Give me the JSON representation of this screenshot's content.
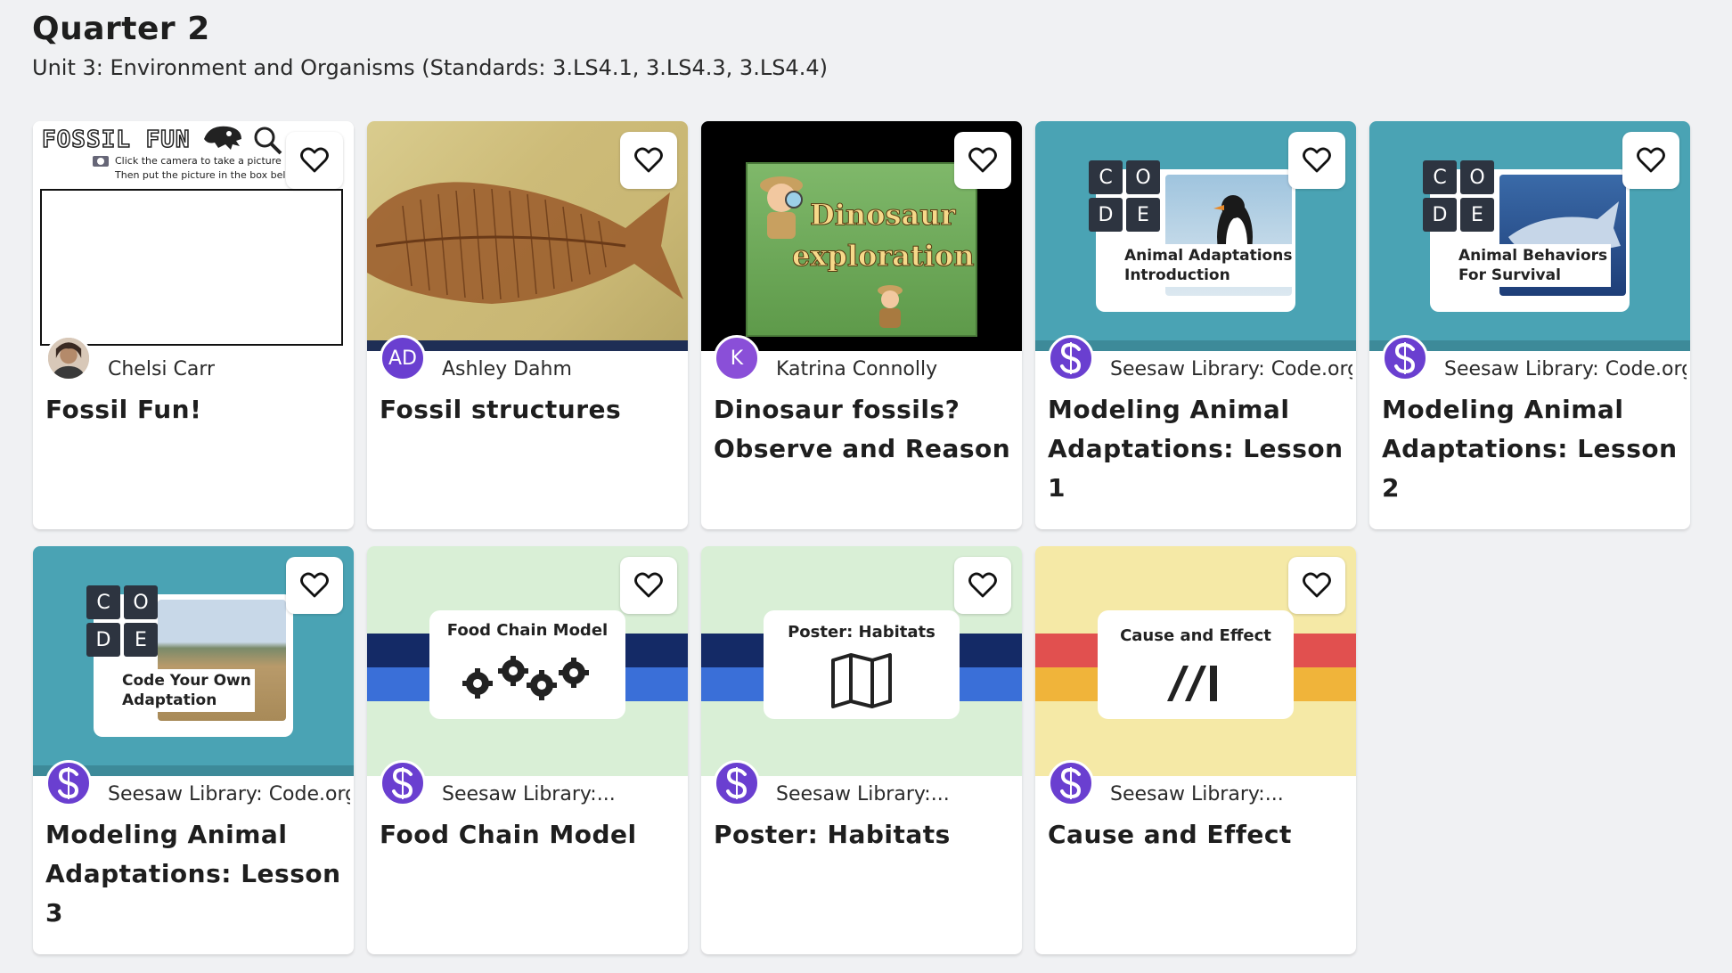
{
  "page": {
    "title": "Quarter 2",
    "subtitle": "Unit 3: Environment and Organisms (Standards: 3.LS4.1, 3.LS4.3, 3.LS4.4)"
  },
  "cards": [
    {
      "title": "Fossil Fun!",
      "author": "Chelsi Carr",
      "thumb": {
        "heading": "FOSSIL FUN",
        "instruction_1": "Click the camera to take a picture",
        "instruction_2": "Then put the picture in the box bel"
      }
    },
    {
      "title": "Fossil structures",
      "author": "Ashley Dahm",
      "avatar_initials": "AD"
    },
    {
      "title": "Dinosaur fossils? Observe and Reason",
      "author": "Katrina Connolly",
      "avatar_initials": "K",
      "thumb": {
        "line_1": "Dinosaur",
        "line_2": "exploration"
      }
    },
    {
      "title": "Modeling Animal Adaptations: Lesson 1",
      "author": "Seesaw Library: Code.org",
      "thumb": {
        "caption_1": "Animal Adaptations",
        "caption_2": "Introduction",
        "code": [
          "C",
          "O",
          "D",
          "E"
        ]
      }
    },
    {
      "title": "Modeling Animal Adaptations: Lesson 2",
      "author": "Seesaw Library: Code.org",
      "thumb": {
        "caption_1": "Animal Behaviors",
        "caption_2": "For Survival",
        "code": [
          "C",
          "O",
          "D",
          "E"
        ]
      }
    },
    {
      "title": "Modeling Animal Adaptations: Lesson 3",
      "author": "Seesaw Library: Code.org",
      "thumb": {
        "caption_1": "Code Your Own",
        "caption_2": "Adaptation",
        "code": [
          "C",
          "O",
          "D",
          "E"
        ]
      }
    },
    {
      "title": "Food Chain Model",
      "author": "Seesaw Library:...",
      "thumb": {
        "caption": "Food Chain Model"
      }
    },
    {
      "title": "Poster: Habitats",
      "author": "Seesaw Library:...",
      "thumb": {
        "caption": "Poster: Habitats"
      }
    },
    {
      "title": "Cause and Effect",
      "author": "Seesaw Library:...",
      "thumb": {
        "caption": "Cause and Effect"
      }
    }
  ],
  "colors": {
    "seesaw_purple": "#6a3fd0",
    "code_teal": "#4aa3b4",
    "stripe_navy": "#142a66",
    "stripe_blue": "#3a6fd8",
    "pastel_green": "#d9efd6",
    "pastel_yellow": "#f5e9a6",
    "stripe_red": "#e1504f",
    "stripe_orange": "#f0b43a"
  },
  "icons": {
    "favorite": "heart-outline-icon",
    "seesaw_logo": "seesaw-s-icon",
    "gears": "gears-icon",
    "map": "folded-map-icon",
    "cause_effect": "slash-bars-icon"
  }
}
